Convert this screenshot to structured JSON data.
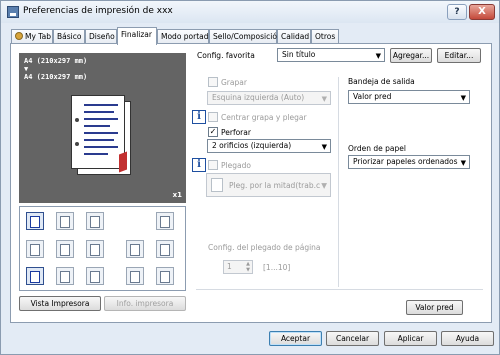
{
  "window": {
    "title": "Preferencias de impresión de xxx",
    "help": "?",
    "close": "X"
  },
  "tabs": [
    {
      "label": "My Tab"
    },
    {
      "label": "Básico"
    },
    {
      "label": "Diseño"
    },
    {
      "label": "Finalizar",
      "active": true
    },
    {
      "label": "Modo portada"
    },
    {
      "label": "Sello/Composición"
    },
    {
      "label": "Calidad"
    },
    {
      "label": "Otros"
    }
  ],
  "preview": {
    "size_line1": "A4 (210x297 mm)",
    "arrow": "▼",
    "size_line2": "A4 (210x297 mm)",
    "copies": "x1"
  },
  "left_buttons": {
    "printer_view": "Vista Impresora",
    "printer_info": "Info. impresora"
  },
  "favorites": {
    "label": "Config. favorita",
    "value": "Sin título",
    "add": "Agregar...",
    "edit": "Editar..."
  },
  "staple": {
    "label": "Grapar",
    "position": "Esquina izquierda (Auto)",
    "center_label": "Centrar grapa y plegar"
  },
  "punch": {
    "label": "Perforar",
    "checked_mark": "✓",
    "value": "2 orificios (izquierda)"
  },
  "fold": {
    "label": "Plegado",
    "value": "Pleg. por la mitad(trab.c"
  },
  "page_fold": {
    "label": "Config. del plegado de página",
    "value": "1",
    "range": "[1...10]"
  },
  "output_tray": {
    "label": "Bandeja de salida",
    "value": "Valor pred"
  },
  "paper_order": {
    "label": "Orden de papel",
    "value": "Priorizar papeles ordenados"
  },
  "default_button": "Valor pred",
  "footer": {
    "ok": "Aceptar",
    "cancel": "Cancelar",
    "apply": "Aplicar",
    "help": "Ayuda"
  },
  "icons": {
    "info": "i",
    "dropdown": "▼",
    "spin_up": "▲",
    "spin_down": "▼"
  }
}
